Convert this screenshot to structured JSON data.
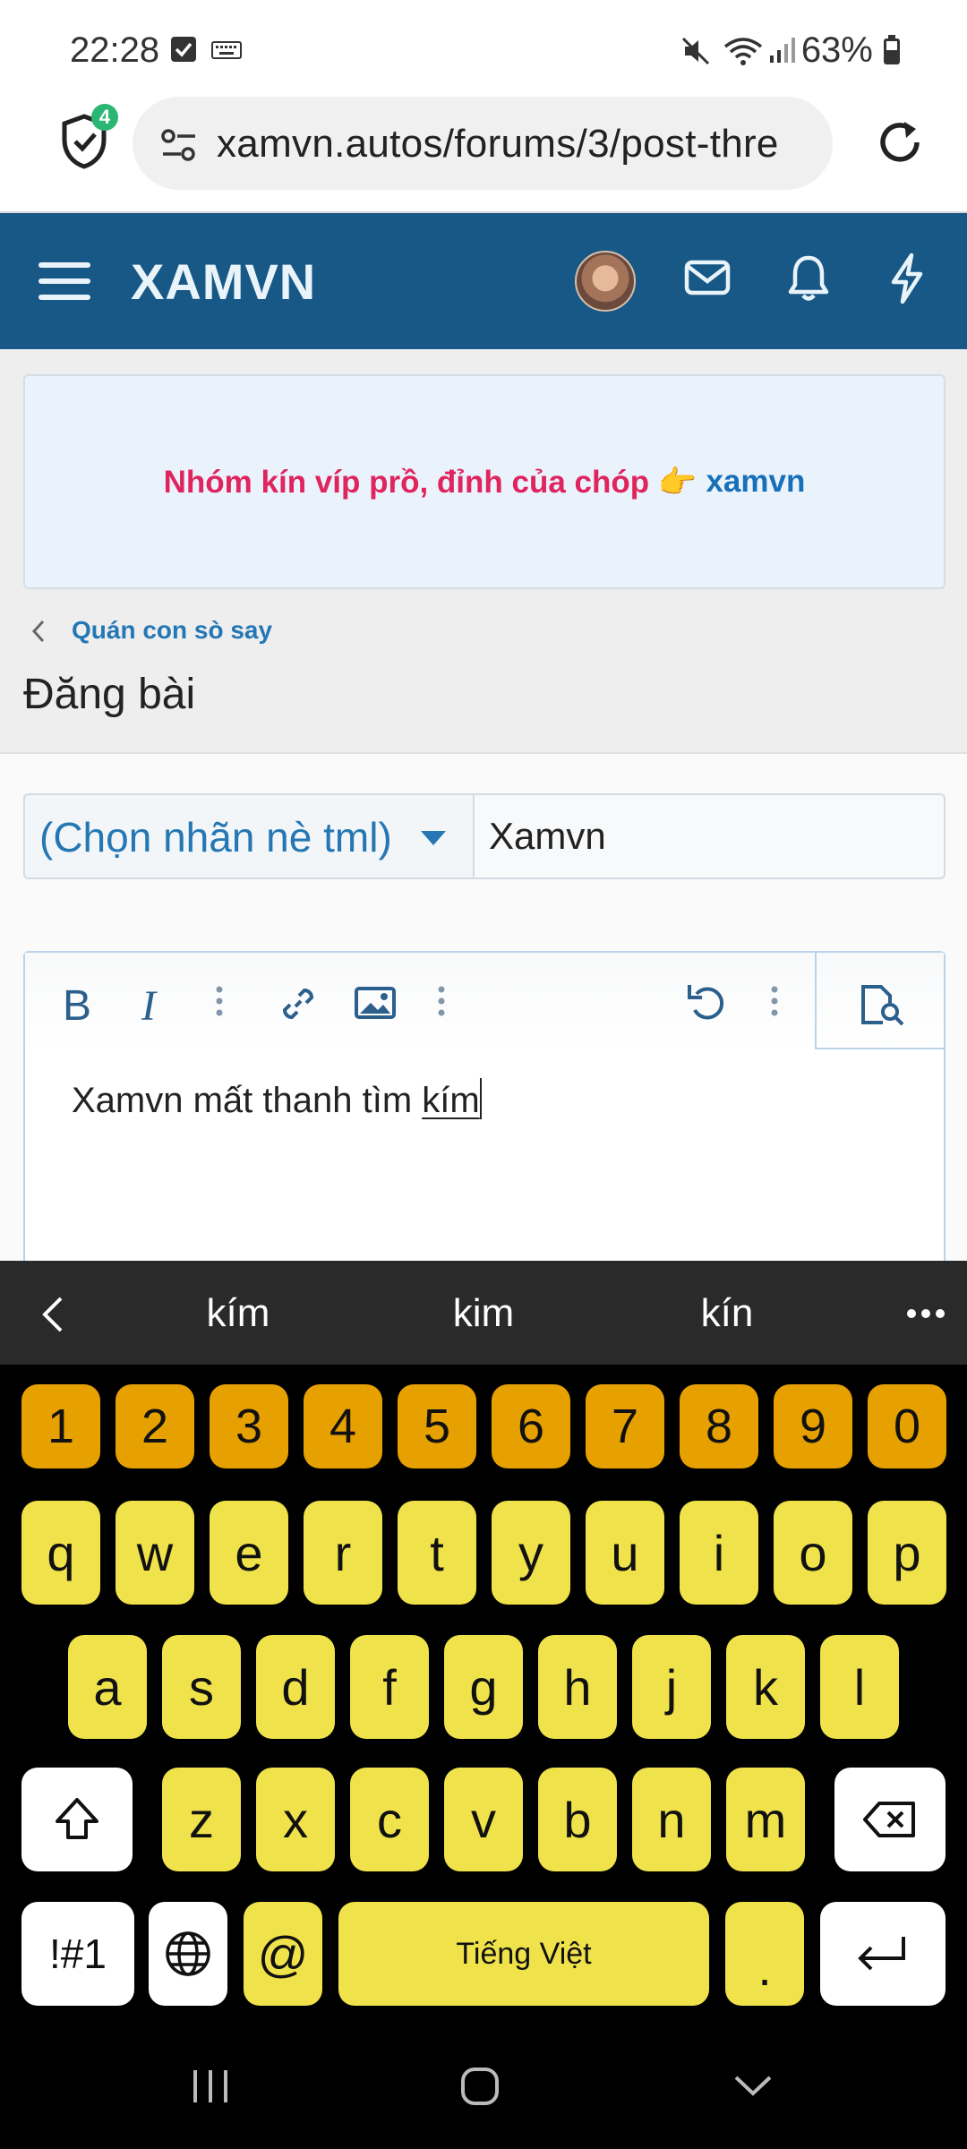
{
  "status_bar": {
    "time": "22:28",
    "battery": "63%",
    "icons": [
      "checkbox-notification-icon",
      "keyboard-icon",
      "mute-icon",
      "wifi-icon",
      "signal-icon",
      "battery-icon"
    ]
  },
  "browser": {
    "url": "xamvn.autos/forums/3/post-thre",
    "shield_badge": "4",
    "icons": [
      "shield-icon",
      "site-settings-icon",
      "reload-icon"
    ]
  },
  "header": {
    "logo": "XAMVN",
    "icons": [
      "menu-icon",
      "avatar",
      "mail-icon",
      "bell-icon",
      "lightning-icon"
    ],
    "bg_color": "#185886"
  },
  "notice": {
    "text": "Nhóm kín víp prồ, đỉnh của chóp 👉",
    "link": "xamvn"
  },
  "breadcrumb": {
    "label": "Quán con sò say"
  },
  "page": {
    "title": "Đăng bài"
  },
  "form": {
    "prefix_select": "(Chọn nhãn nè tml)",
    "title_value": "Xamvn",
    "editor_text": "Xamvn mất thanh tìm ",
    "editor_underlined": "kím",
    "toolbar_icons": [
      "bold-icon",
      "italic-icon",
      "more-text-icon",
      "link-icon",
      "image-icon",
      "more-insert-icon",
      "undo-icon",
      "more-options-icon",
      "preview-icon"
    ],
    "toolbar_labels": {
      "bold": "B",
      "italic": "I"
    }
  },
  "suggestions": [
    "kím",
    "kim",
    "kín"
  ],
  "keyboard": {
    "numbers": [
      "1",
      "2",
      "3",
      "4",
      "5",
      "6",
      "7",
      "8",
      "9",
      "0"
    ],
    "row1": [
      "q",
      "w",
      "e",
      "r",
      "t",
      "y",
      "u",
      "i",
      "o",
      "p"
    ],
    "row2": [
      "a",
      "s",
      "d",
      "f",
      "g",
      "h",
      "j",
      "k",
      "l"
    ],
    "row3": [
      "z",
      "x",
      "c",
      "v",
      "b",
      "n",
      "m"
    ],
    "symbols_key": "!#1",
    "at_key": "@",
    "space_label": "Tiếng Việt",
    "period_key": ".",
    "colors": {
      "number_keys": "#e6a000",
      "letter_keys": "#f0e24a",
      "background": "#000000"
    }
  },
  "nav": {
    "icons": [
      "recents-icon",
      "home-icon",
      "back-icon"
    ]
  }
}
